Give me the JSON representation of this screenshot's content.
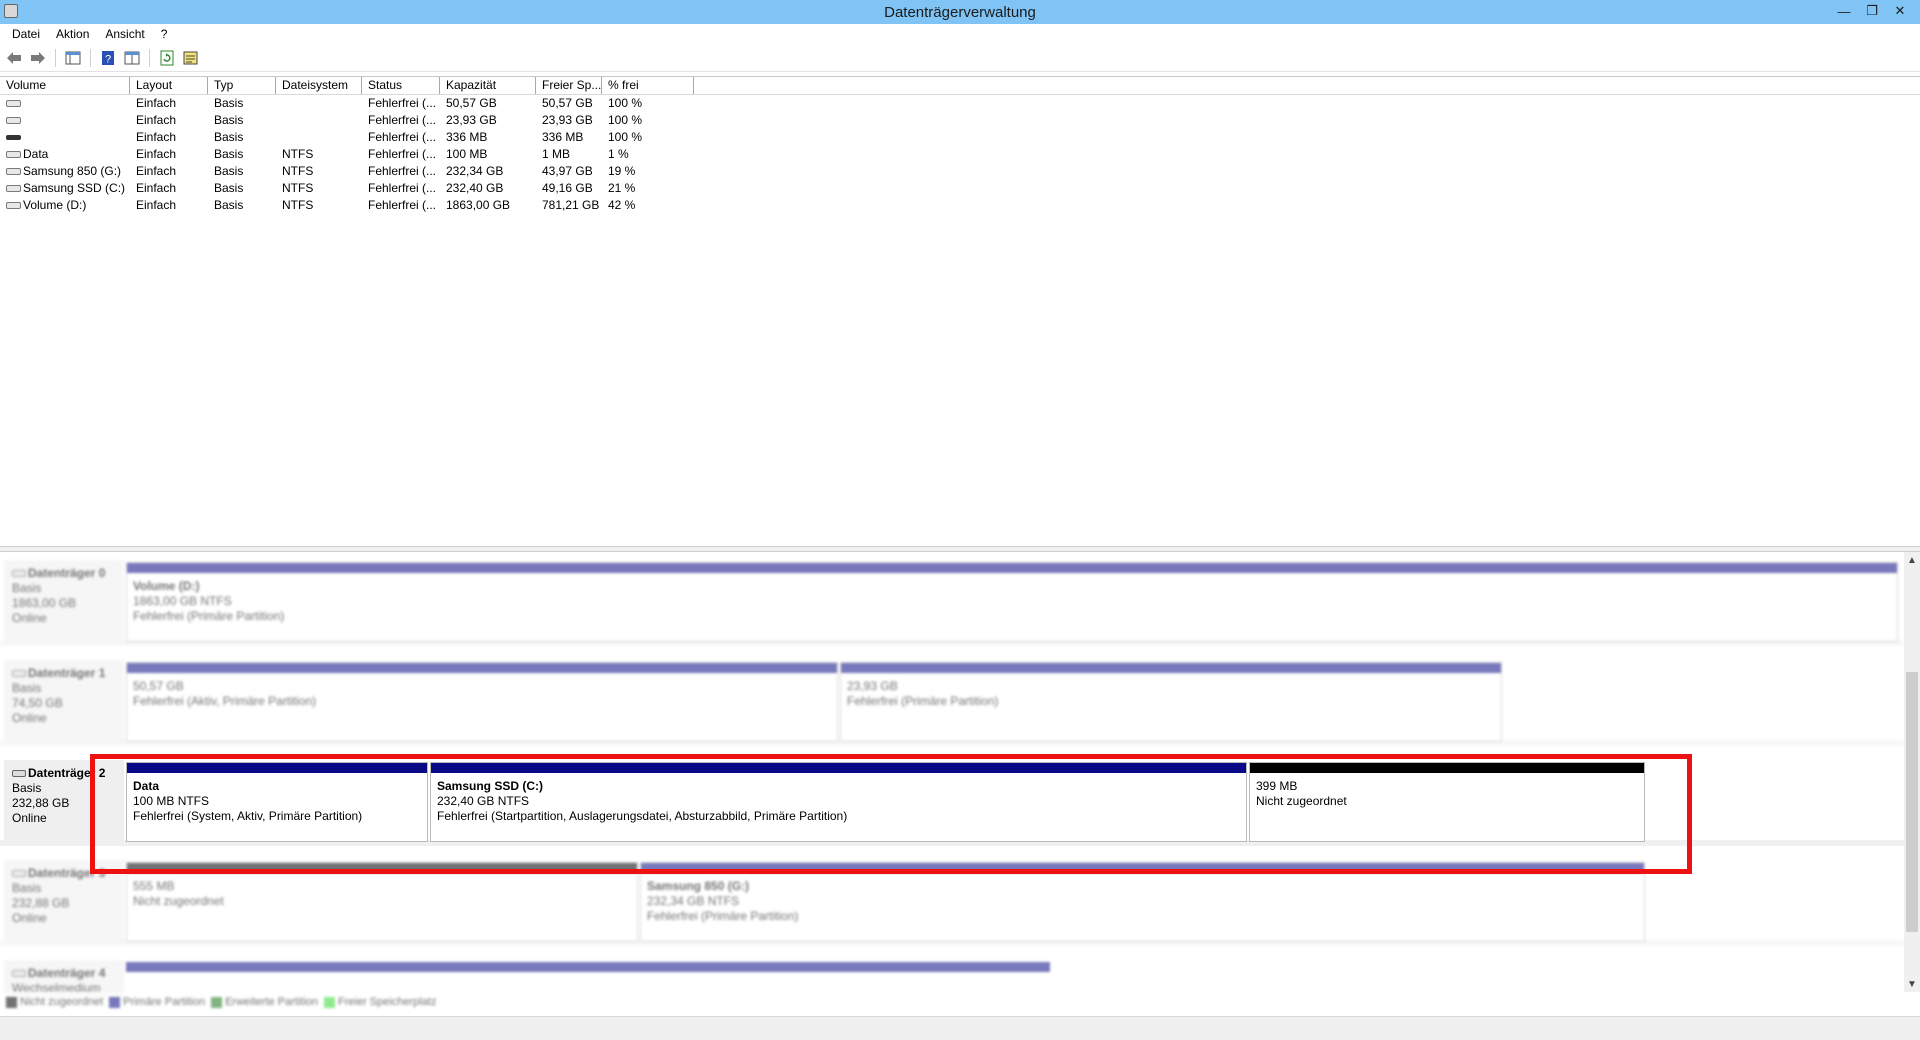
{
  "window": {
    "title": "Datenträgerverwaltung"
  },
  "menu": [
    "Datei",
    "Aktion",
    "Ansicht",
    "?"
  ],
  "toolbar": {
    "icons": [
      "back-arrow-icon",
      "forward-arrow-icon",
      "console-tree-icon",
      "help-icon",
      "properties-icon",
      "refresh-icon",
      "rescan-icon"
    ]
  },
  "volume_list": {
    "columns": [
      "Volume",
      "Layout",
      "Typ",
      "Dateisystem",
      "Status",
      "Kapazität",
      "Freier Sp...",
      "% frei"
    ],
    "rows": [
      {
        "volume": "",
        "layout": "Einfach",
        "typ": "Basis",
        "fs": "",
        "status": "Fehlerfrei (...",
        "kap": "50,57 GB",
        "frei": "50,57 GB",
        "pct": "100 %"
      },
      {
        "volume": "",
        "layout": "Einfach",
        "typ": "Basis",
        "fs": "",
        "status": "Fehlerfrei (...",
        "kap": "23,93 GB",
        "frei": "23,93 GB",
        "pct": "100 %"
      },
      {
        "volume": "",
        "layout": "Einfach",
        "typ": "Basis",
        "fs": "",
        "status": "Fehlerfrei (...",
        "kap": "336 MB",
        "frei": "336 MB",
        "pct": "100 %"
      },
      {
        "volume": "Data",
        "layout": "Einfach",
        "typ": "Basis",
        "fs": "NTFS",
        "status": "Fehlerfrei (...",
        "kap": "100 MB",
        "frei": "1 MB",
        "pct": "1 %"
      },
      {
        "volume": "Samsung 850  (G:)",
        "layout": "Einfach",
        "typ": "Basis",
        "fs": "NTFS",
        "status": "Fehlerfrei (...",
        "kap": "232,34 GB",
        "frei": "43,97 GB",
        "pct": "19 %"
      },
      {
        "volume": "Samsung SSD (C:)",
        "layout": "Einfach",
        "typ": "Basis",
        "fs": "NTFS",
        "status": "Fehlerfrei (...",
        "kap": "232,40 GB",
        "frei": "49,16 GB",
        "pct": "21 %"
      },
      {
        "volume": "Volume (D:)",
        "layout": "Einfach",
        "typ": "Basis",
        "fs": "NTFS",
        "status": "Fehlerfrei (...",
        "kap": "1863,00 GB",
        "frei": "781,21 GB",
        "pct": "42 %"
      }
    ]
  },
  "disks": [
    {
      "name": "Datenträger 0",
      "type": "Basis",
      "size": "1863,00 GB",
      "state": "Online",
      "partitions": [
        {
          "name": "Volume  (D:)",
          "line1": "1863,00 GB NTFS",
          "line2": "Fehlerfrei (Primäre Partition)"
        }
      ]
    },
    {
      "name": "Datenträger 1",
      "type": "Basis",
      "size": "74,50 GB",
      "state": "Online",
      "partitions": [
        {
          "name": "",
          "line1": "50,57 GB",
          "line2": "Fehlerfrei (Aktiv, Primäre Partition)"
        },
        {
          "name": "",
          "line1": "23,93 GB",
          "line2": "Fehlerfrei (Primäre Partition)"
        }
      ]
    },
    {
      "name": "Datenträger 2",
      "type": "Basis",
      "size": "232,88 GB",
      "state": "Online",
      "partitions": [
        {
          "name": "Data",
          "line1": "100 MB NTFS",
          "line2": "Fehlerfrei (System, Aktiv, Primäre Partition)"
        },
        {
          "name": "Samsung SSD  (C:)",
          "line1": "232,40 GB NTFS",
          "line2": "Fehlerfrei (Startpartition, Auslagerungsdatei, Absturzabbild, Primäre Partition)"
        },
        {
          "name": "",
          "line1": "399 MB",
          "line2": "Nicht zugeordnet"
        }
      ]
    },
    {
      "name": "Datenträger 3",
      "type": "Basis",
      "size": "232,88 GB",
      "state": "Online",
      "partitions": [
        {
          "name": "",
          "line1": "555 MB",
          "line2": "Nicht zugeordnet"
        },
        {
          "name": "Samsung 850  (G:)",
          "line1": "232,34 GB NTFS",
          "line2": "Fehlerfrei (Primäre Partition)"
        }
      ]
    },
    {
      "name": "Datenträger 4",
      "type": "Wechselmedium",
      "size": "",
      "state": "",
      "partitions": []
    }
  ],
  "legend": [
    {
      "label": "Nicht zugeordnet",
      "color": "#000000"
    },
    {
      "label": "Primäre Partition",
      "color": "#0a0a86"
    },
    {
      "label": "Erweiterte Partition",
      "color": "#1a7a1a"
    },
    {
      "label": "Freier Speicherplatz",
      "color": "#33dd33"
    }
  ],
  "colors": {
    "highlight": "#ee1111",
    "titlebar": "#7fc4f5",
    "primary_partition": "#0a0a86"
  }
}
